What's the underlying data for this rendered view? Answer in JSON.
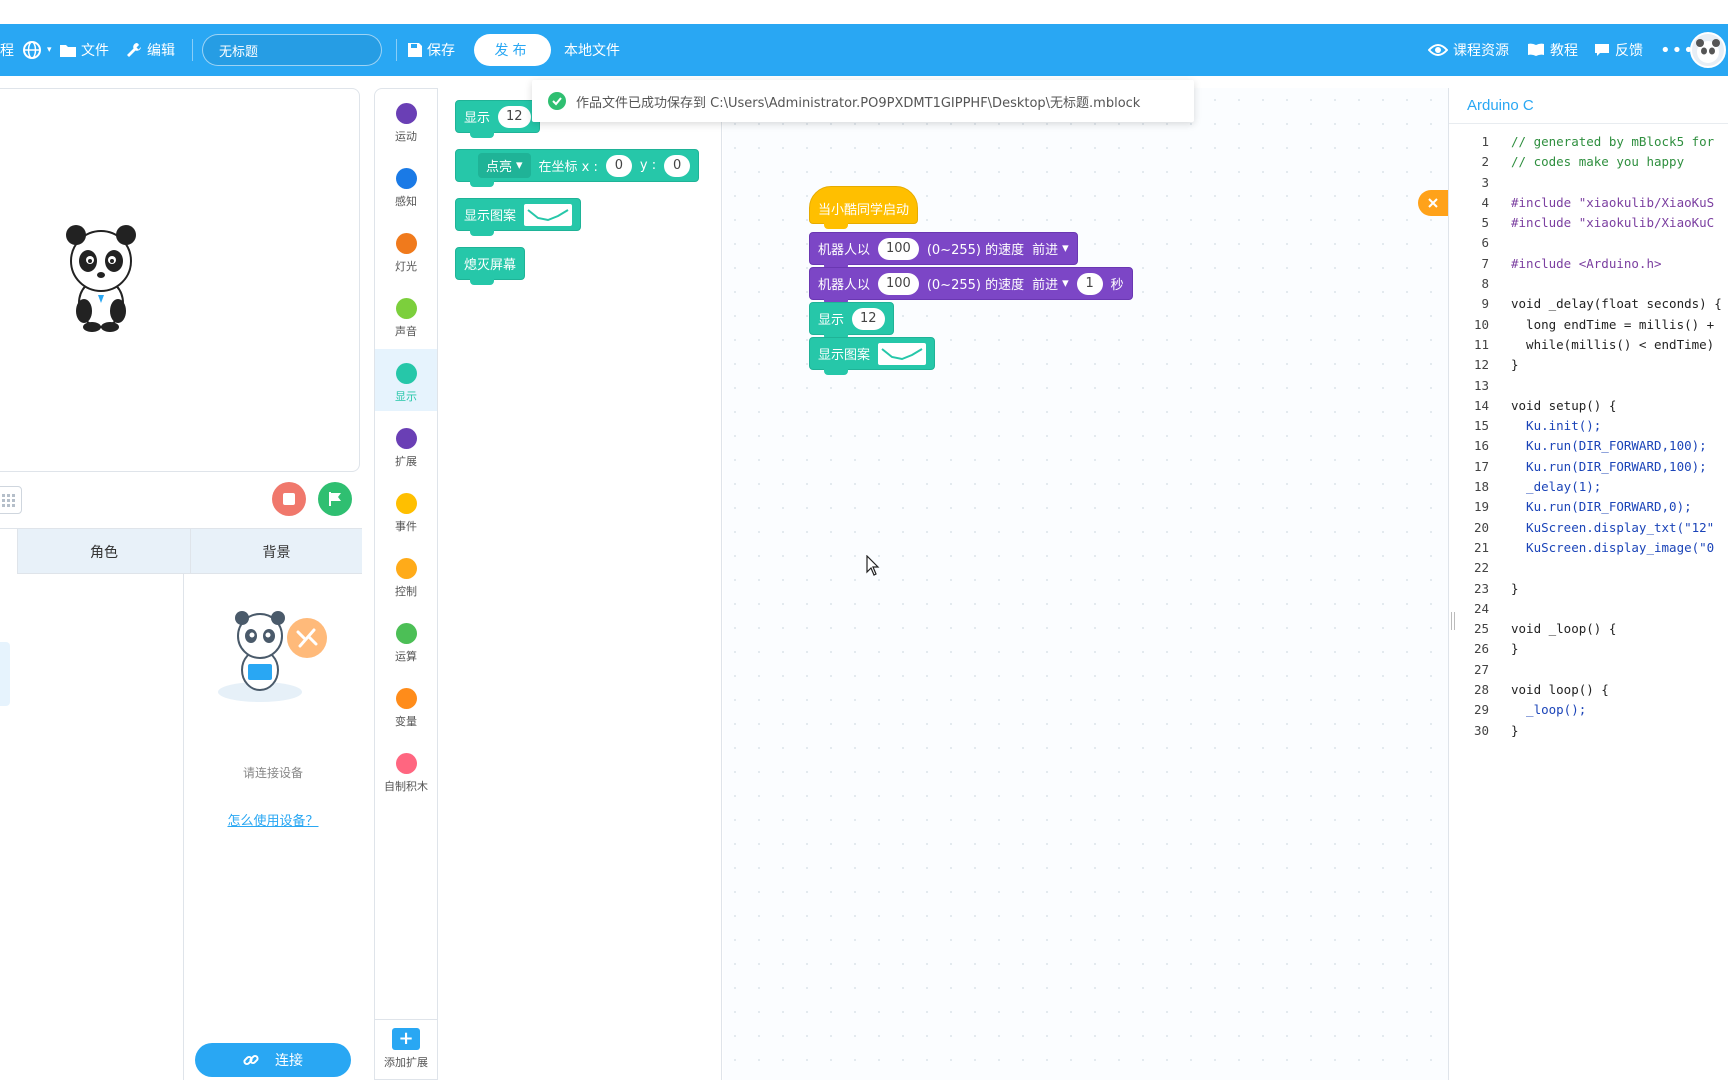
{
  "toolbar": {
    "cut_label": "程",
    "file_label": "文件",
    "edit_label": "编辑",
    "project_title": "无标题",
    "save_label": "保存",
    "publish_label": "发布",
    "local_file_label": "本地文件",
    "course_resources_label": "课程资源",
    "tutorial_label": "教程",
    "feedback_label": "反馈"
  },
  "toast": {
    "message": "作品文件已成功保存到 C:\\Users\\Administrator.PO9PXDMT1GIPPHF\\Desktop\\无标题.mblock"
  },
  "sprite_tabs": {
    "sprite": "角色",
    "background": "背景"
  },
  "device": {
    "connect_hint": "请连接设备",
    "howto_link": "怎么使用设备？",
    "connect_label": "连接"
  },
  "categories": [
    {
      "label": "运动",
      "color": "#6a3fb5"
    },
    {
      "label": "感知",
      "color": "#1a7ae6"
    },
    {
      "label": "灯光",
      "color": "#f07a1c"
    },
    {
      "label": "声音",
      "color": "#7ccf3c"
    },
    {
      "label": "显示",
      "color": "#26c7a9"
    },
    {
      "label": "扩展",
      "color": "#6a3fb5"
    },
    {
      "label": "事件",
      "color": "#ffbf00"
    },
    {
      "label": "控制",
      "color": "#ffab19"
    },
    {
      "label": "运算",
      "color": "#4cbf56"
    },
    {
      "label": "变量",
      "color": "#ff8c1a"
    },
    {
      "label": "自制积木",
      "color": "#ff6680"
    }
  ],
  "add_extension_label": "添加扩展",
  "palette_blocks": {
    "show_label": "显示",
    "show_value": "12",
    "light_label": "点亮",
    "at_coords_label": "在坐标 x :",
    "x_value": "0",
    "y_label": "y :",
    "y_value": "0",
    "show_pattern_label": "显示图案",
    "clear_screen_label": "熄灭屏幕"
  },
  "script": {
    "hat_label": "当小酷同学启动",
    "move1": {
      "prefix": "机器人以",
      "speed": "100",
      "suffix": "(0~255) 的速度",
      "direction": "前进"
    },
    "move2": {
      "prefix": "机器人以",
      "speed": "100",
      "suffix": "(0~255) 的速度",
      "direction": "前进",
      "duration": "1",
      "unit": "秒"
    },
    "show_label": "显示",
    "show_value": "12",
    "show_pattern_label": "显示图案"
  },
  "code_panel": {
    "title": "Arduino C",
    "lines": [
      {
        "n": "1",
        "t": "// generated by mBlock5 for",
        "k": "comment"
      },
      {
        "n": "2",
        "t": "// codes make you happy",
        "k": "comment"
      },
      {
        "n": "3",
        "t": "",
        "k": "plain"
      },
      {
        "n": "4",
        "t": "#include \"xiaokulib/XiaoKuS",
        "k": "pre"
      },
      {
        "n": "5",
        "t": "#include \"xiaokulib/XiaoKuC",
        "k": "pre"
      },
      {
        "n": "6",
        "t": "",
        "k": "plain"
      },
      {
        "n": "7",
        "t": "#include <Arduino.h>",
        "k": "pre"
      },
      {
        "n": "8",
        "t": "",
        "k": "plain"
      },
      {
        "n": "9",
        "t": "void _delay(float seconds) {",
        "k": "plain"
      },
      {
        "n": "10",
        "t": "  long endTime = millis() +",
        "k": "plain"
      },
      {
        "n": "11",
        "t": "  while(millis() < endTime)",
        "k": "plain"
      },
      {
        "n": "12",
        "t": "}",
        "k": "plain"
      },
      {
        "n": "13",
        "t": "",
        "k": "plain"
      },
      {
        "n": "14",
        "t": "void setup() {",
        "k": "plain"
      },
      {
        "n": "15",
        "t": "  Ku.init();",
        "k": "kw"
      },
      {
        "n": "16",
        "t": "  Ku.run(DIR_FORWARD,100);",
        "k": "kw"
      },
      {
        "n": "17",
        "t": "  Ku.run(DIR_FORWARD,100);",
        "k": "kw"
      },
      {
        "n": "18",
        "t": "  _delay(1);",
        "k": "kw"
      },
      {
        "n": "19",
        "t": "  Ku.run(DIR_FORWARD,0);",
        "k": "kw"
      },
      {
        "n": "20",
        "t": "  KuScreen.display_txt(\"12\"",
        "k": "kw"
      },
      {
        "n": "21",
        "t": "  KuScreen.display_image(\"0",
        "k": "kw"
      },
      {
        "n": "22",
        "t": "",
        "k": "plain"
      },
      {
        "n": "23",
        "t": "}",
        "k": "plain"
      },
      {
        "n": "24",
        "t": "",
        "k": "plain"
      },
      {
        "n": "25",
        "t": "void _loop() {",
        "k": "plain"
      },
      {
        "n": "26",
        "t": "}",
        "k": "plain"
      },
      {
        "n": "27",
        "t": "",
        "k": "plain"
      },
      {
        "n": "28",
        "t": "void loop() {",
        "k": "plain"
      },
      {
        "n": "29",
        "t": "  _loop();",
        "k": "kw"
      },
      {
        "n": "30",
        "t": "}",
        "k": "plain"
      }
    ]
  },
  "colors": {
    "topbar": "#29a7f3",
    "display_block": "#26c7a9",
    "motion_block": "#7c46c6",
    "event_block": "#ffbf00"
  }
}
